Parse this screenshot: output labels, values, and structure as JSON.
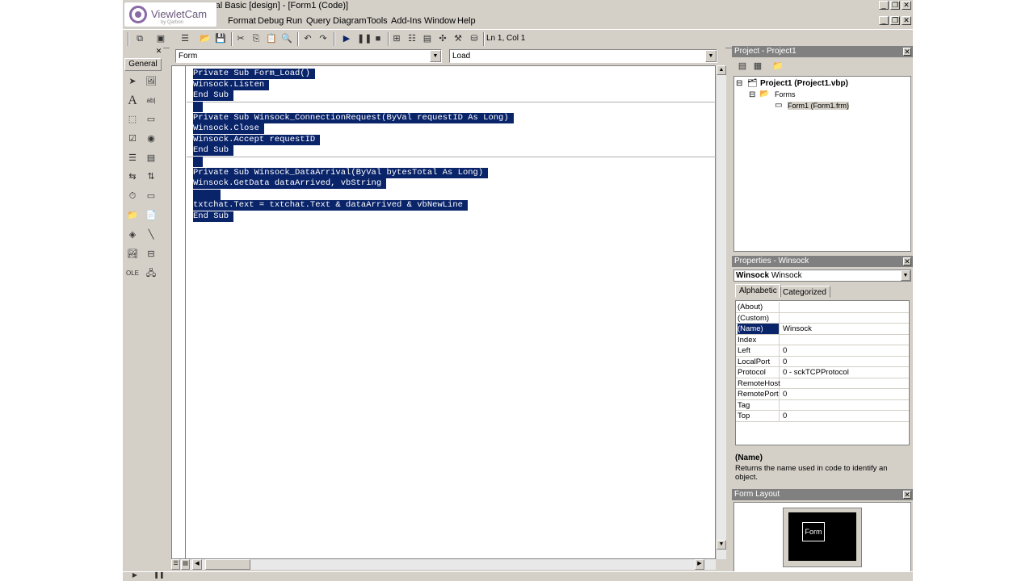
{
  "watermark": {
    "brand": "ViewletCam",
    "sub": "by Qarbon"
  },
  "window": {
    "title": "sual Basic [design] - [Form1 (Code)]"
  },
  "menu": [
    "Format",
    "Debug",
    "Run",
    "Query",
    "Diagram",
    "Tools",
    "Add-Ins",
    "Window",
    "Help"
  ],
  "toolbar": {
    "position": "Ln 1, Col 1"
  },
  "toolbox": {
    "tab": "General"
  },
  "code": {
    "object": "Form",
    "procedure": "Load",
    "lines": [
      "Private Sub Form_Load()",
      "Winsock.Listen",
      "End Sub",
      "",
      "Private Sub Winsock_ConnectionRequest(ByVal requestID As Long)",
      "Winsock.Close",
      "Winsock.Accept requestID",
      "End Sub",
      "",
      "Private Sub Winsock_DataArrival(ByVal bytesTotal As Long)",
      "Winsock.GetData dataArrived, vbString",
      "",
      "txtchat.Text = txtchat.Text & dataArrived & vbNewLine",
      "End Sub"
    ]
  },
  "project": {
    "title": "Project - Project1",
    "root": "Project1 (Project1.vbp)",
    "folder": "Forms",
    "form": "Form1 (Form1.frm)"
  },
  "properties": {
    "title": "Properties - Winsock",
    "object_bold": "Winsock",
    "object_type": "Winsock",
    "tabs": [
      "Alphabetic",
      "Categorized"
    ],
    "rows": [
      {
        "name": "(About)",
        "value": ""
      },
      {
        "name": "(Custom)",
        "value": ""
      },
      {
        "name": "(Name)",
        "value": "Winsock"
      },
      {
        "name": "Index",
        "value": ""
      },
      {
        "name": "Left",
        "value": "0"
      },
      {
        "name": "LocalPort",
        "value": "0"
      },
      {
        "name": "Protocol",
        "value": "0 - sckTCPProtocol"
      },
      {
        "name": "RemoteHost",
        "value": ""
      },
      {
        "name": "RemotePort",
        "value": "0"
      },
      {
        "name": "Tag",
        "value": ""
      },
      {
        "name": "Top",
        "value": "0"
      }
    ],
    "desc_title": "(Name)",
    "desc_text": "Returns the name used in code to identify an object."
  },
  "form_layout": {
    "title": "Form Layout",
    "form_label": "Form"
  }
}
